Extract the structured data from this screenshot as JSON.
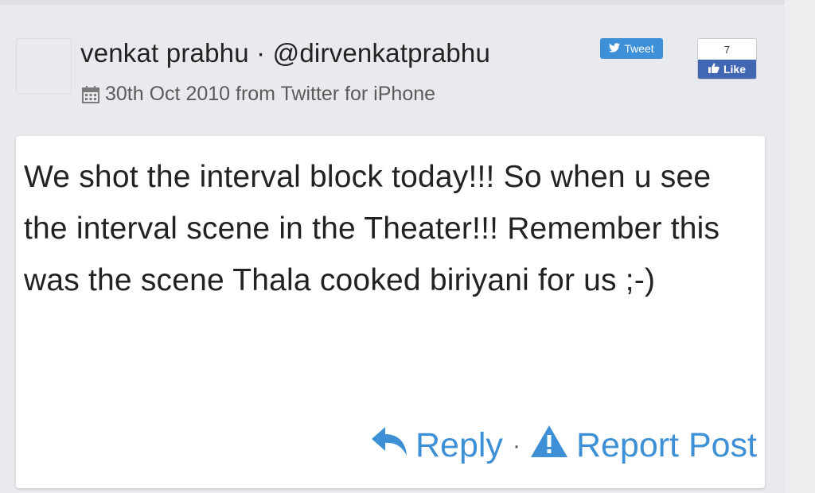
{
  "post": {
    "author": "venkat prabhu · @dirvenkatprabhu",
    "date": "30th Oct 2010 from Twitter for iPhone",
    "text": "We shot the interval block today!!! So when u see the interval scene in the Theater!!! Remember this was the scene Thala cooked biriyani for us ;-)"
  },
  "share": {
    "tweet_label": "Tweet",
    "like_count": "7",
    "like_label": "Like"
  },
  "actions": {
    "reply_label": "Reply",
    "separator": "·",
    "report_label": "Report Post"
  },
  "icons": {
    "date": "calendar-icon",
    "tweet": "twitter-bird-icon",
    "like": "thumbs-up-icon",
    "reply": "reply-arrow-icon",
    "report": "warning-triangle-icon"
  },
  "colors": {
    "background": "#e9eaed",
    "accent": "#3d8fd6",
    "facebook": "#4267b2",
    "text": "#222222"
  }
}
